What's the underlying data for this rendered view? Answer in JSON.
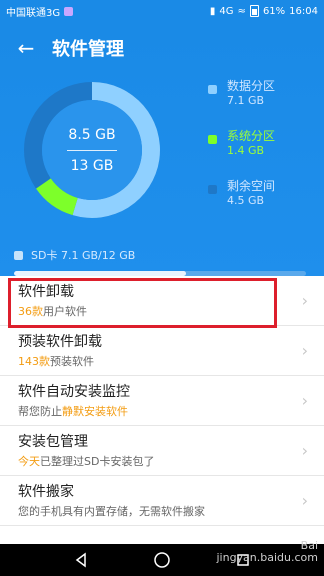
{
  "status": {
    "carrier": "中国联通3G",
    "signal": "4G",
    "battery": "61%",
    "time": "16:04"
  },
  "header": {
    "back_icon": "arrow-left-icon",
    "title": "软件管理"
  },
  "storage": {
    "used": "8.5 GB",
    "total": "13 GB",
    "colors": {
      "data": "#8fd0ff",
      "system": "#7dff2a",
      "free": "#1e78c8"
    },
    "legend": [
      {
        "name": "数据分区",
        "value": "7.1 GB"
      },
      {
        "name": "系统分区",
        "value": "1.4 GB"
      },
      {
        "name": "剩余空间",
        "value": "4.5 GB"
      }
    ],
    "chart_values": [
      7.1,
      1.4,
      4.5
    ],
    "sd_label": "SD卡 7.1 GB/12 GB",
    "sd_fraction": 0.59
  },
  "list": [
    {
      "title": "软件卸载",
      "sub_hl": "36款",
      "sub_rest": "用户软件"
    },
    {
      "title": "预装软件卸载",
      "sub_hl": "143款",
      "sub_rest": "预装软件"
    },
    {
      "title": "软件自动安装监控",
      "sub_pre": "帮您防止",
      "sub_hl": "静默安装软件"
    },
    {
      "title": "安装包管理",
      "sub_hl": "今天",
      "sub_rest": "已整理过SD卡安装包了"
    },
    {
      "title": "软件搬家",
      "sub_rest": "您的手机具有内置存储，无需软件搬家"
    }
  ],
  "watermark": {
    "line1": "Bai",
    "line2": "jingyan.baidu.com"
  }
}
